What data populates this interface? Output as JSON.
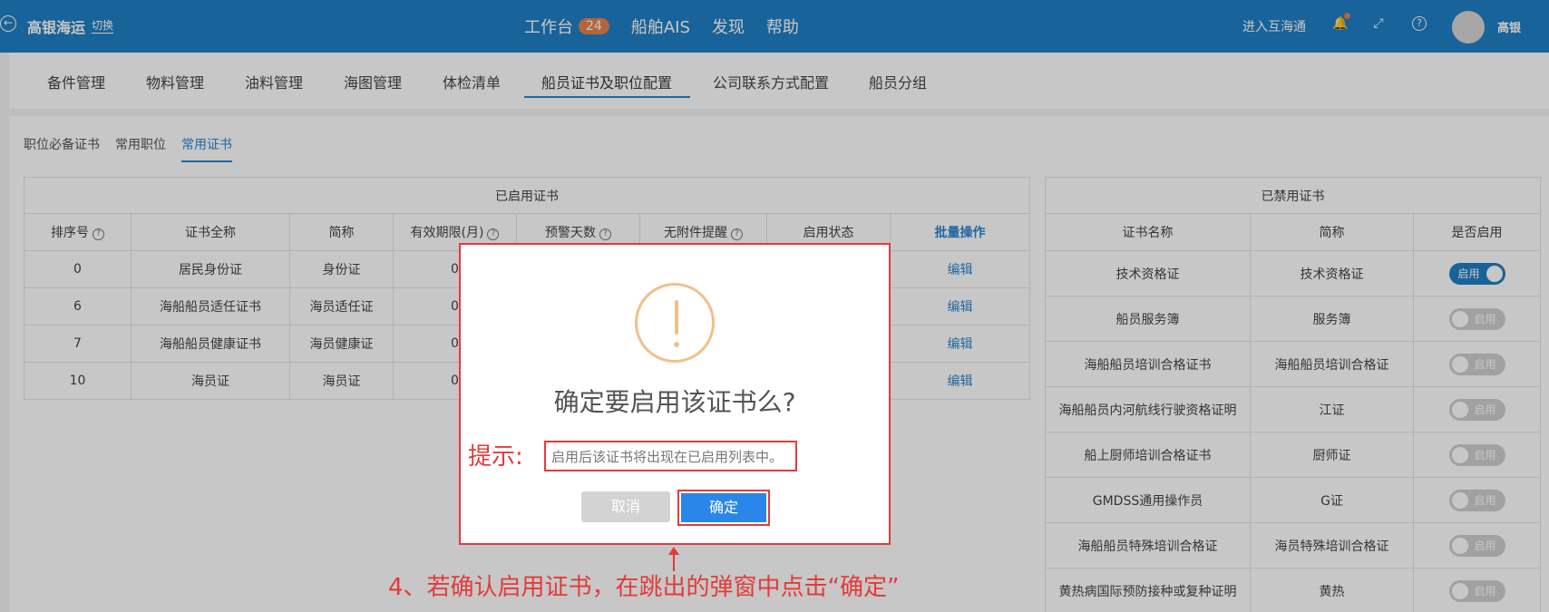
{
  "topbar": {
    "brand": "高银海运",
    "switch": "切换",
    "nav": [
      {
        "label": "工作台",
        "badge": "24"
      },
      {
        "label": "船舶AIS"
      },
      {
        "label": "发现"
      },
      {
        "label": "帮助"
      }
    ],
    "enter_link": "进入互海通",
    "user_name": "高银"
  },
  "subnav": {
    "tabs": [
      "备件管理",
      "物料管理",
      "油料管理",
      "海图管理",
      "体检清单",
      "船员证书及职位配置",
      "公司联系方式配置",
      "船员分组"
    ],
    "active": "船员证书及职位配置"
  },
  "cert_tabs": {
    "tabs": [
      "职位必备证书",
      "常用职位",
      "常用证书"
    ],
    "active": "常用证书"
  },
  "enabled_table": {
    "caption": "已启用证书",
    "headers": [
      "排序号",
      "证书全称",
      "简称",
      "有效期限(月)",
      "预警天数",
      "无附件提醒",
      "启用状态",
      "批量操作"
    ],
    "rows": [
      {
        "order": "0",
        "full": "居民身份证",
        "short": "身份证",
        "months": "0",
        "action": "编辑"
      },
      {
        "order": "6",
        "full": "海船船员适任证书",
        "short": "海员适任证",
        "months": "0",
        "action": "编辑"
      },
      {
        "order": "7",
        "full": "海船船员健康证书",
        "short": "海员健康证",
        "months": "0",
        "action": "编辑"
      },
      {
        "order": "10",
        "full": "海员证",
        "short": "海员证",
        "months": "0",
        "action": "编辑"
      }
    ]
  },
  "disabled_table": {
    "caption": "已禁用证书",
    "headers": [
      "证书名称",
      "简称",
      "是否启用"
    ],
    "rows": [
      {
        "name": "技术资格证",
        "short": "技术资格证",
        "toggle": "启用",
        "on": true
      },
      {
        "name": "船员服务簿",
        "short": "服务簿",
        "toggle": "启用",
        "on": false
      },
      {
        "name": "海船船员培训合格证书",
        "short": "海船船员培训合格证",
        "toggle": "启用",
        "on": false
      },
      {
        "name": "海船船员内河航线行驶资格证明",
        "short": "江证",
        "toggle": "启用",
        "on": false
      },
      {
        "name": "船上厨师培训合格证书",
        "short": "厨师证",
        "toggle": "启用",
        "on": false
      },
      {
        "name": "GMDSS通用操作员",
        "short": "G证",
        "toggle": "启用",
        "on": false
      },
      {
        "name": "海船船员特殊培训合格证",
        "short": "海员特殊培训合格证",
        "toggle": "启用",
        "on": false
      },
      {
        "name": "黄热病国际预防接种或复种证明",
        "short": "黄热",
        "toggle": "启用",
        "on": false
      }
    ]
  },
  "modal": {
    "title": "确定要启用该证书么?",
    "hint_label": "提示:",
    "hint_text": "启用后该证书将出现在已启用列表中。",
    "cancel": "取消",
    "ok": "确定"
  },
  "annotation": "4、若确认启用证书，在跳出的弹窗中点击“确定”",
  "colors": {
    "topbar": "#1f7fc4",
    "accent": "#2a86d0",
    "annotation_red": "#e43a3a",
    "warning": "#f2bf8a",
    "ok_button": "#2a86e8"
  }
}
